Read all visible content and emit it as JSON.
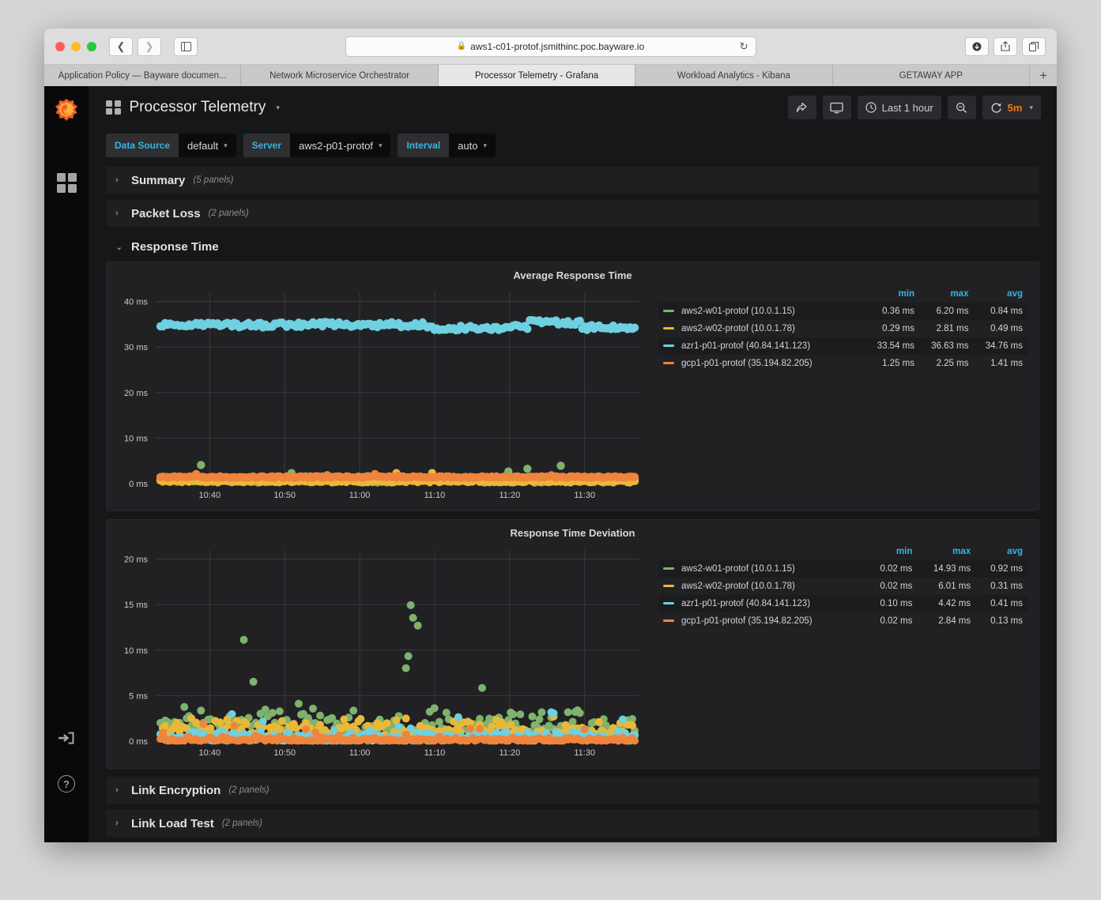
{
  "browser": {
    "url": "aws1-c01-protof.jsmithinc.poc.bayware.io",
    "lock_icon": "lock-icon",
    "reload_icon": "reload-icon",
    "back_icon": "chevron-left-icon",
    "forward_icon": "chevron-right-icon",
    "sidebar_icon": "sidebar-toggle-icon",
    "download_icon": "download-icon",
    "share_icon": "share-icon",
    "tabs_icon": "tab-overview-icon",
    "new_tab_label": "+",
    "tabs": [
      {
        "label": "Application Policy — Bayware documen...",
        "active": false
      },
      {
        "label": "Network Microservice Orchestrator",
        "active": false
      },
      {
        "label": "Processor Telemetry - Grafana",
        "active": true
      },
      {
        "label": "Workload Analytics - Kibana",
        "active": false
      },
      {
        "label": "GETAWAY APP",
        "active": false
      }
    ]
  },
  "sidebar": {
    "logo": "grafana-logo-icon",
    "items": [
      {
        "name": "dashboards-icon"
      },
      {
        "name": "sign-in-icon"
      },
      {
        "name": "help-icon",
        "glyph": "?"
      }
    ]
  },
  "header": {
    "title": "Processor Telemetry",
    "title_caret": "▾",
    "share_label": "share-icon",
    "tv_label": "tv-mode-icon",
    "time_range": "Last 1 hour",
    "clock_icon": "clock-icon",
    "zoom_out_icon": "zoom-out-icon",
    "refresh_icon": "refresh-icon",
    "refresh_interval": "5m",
    "refresh_caret": "▾"
  },
  "submenu": {
    "vars": [
      {
        "label": "Data Source",
        "value": "default",
        "caret": "▾"
      },
      {
        "label": "Server",
        "value": "aws2-p01-protof",
        "caret": "▾"
      },
      {
        "label": "Interval",
        "value": "auto",
        "caret": "▾"
      }
    ]
  },
  "rows": [
    {
      "title": "Summary",
      "count": "(5 panels)",
      "expanded": false,
      "chevron": "›"
    },
    {
      "title": "Packet Loss",
      "count": "(2 panels)",
      "expanded": false,
      "chevron": "›"
    },
    {
      "title": "Response Time",
      "count": "",
      "expanded": true,
      "chevron": "⌄"
    },
    {
      "title": "Link Encryption",
      "count": "(2 panels)",
      "expanded": false,
      "chevron": "›"
    },
    {
      "title": "Link Load Test",
      "count": "(2 panels)",
      "expanded": false,
      "chevron": "›"
    }
  ],
  "legend_headers": {
    "name": "",
    "min": "min",
    "max": "max",
    "avg": "avg"
  },
  "colors": {
    "green": "#7eb26d",
    "yellow": "#eab839",
    "cyan": "#6ed0e0",
    "orange": "#ef843c",
    "accent_blue": "#33b5e5",
    "accent_orange": "#eb7b18",
    "panel_bg": "#212124",
    "page_bg": "#161719"
  },
  "chart_data": [
    {
      "type": "scatter",
      "title": "Average Response Time",
      "xlabel": "",
      "ylabel": "",
      "ylim": [
        0,
        42
      ],
      "yticks": [
        0,
        10,
        20,
        30,
        40
      ],
      "ytick_labels": [
        "0 ms",
        "10 ms",
        "20 ms",
        "30 ms",
        "40 ms"
      ],
      "xticks": [
        "10:40",
        "10:50",
        "11:00",
        "11:10",
        "11:20",
        "11:30"
      ],
      "grid": true,
      "legend_position": "right",
      "series": [
        {
          "name": "aws2-w01-protof (10.0.1.15)",
          "color": "#7eb26d",
          "min": "0.36 ms",
          "max": "6.20 ms",
          "avg": "0.84 ms",
          "mean": 0.84,
          "spread": 1.4,
          "spike_max": 6.2
        },
        {
          "name": "aws2-w02-protof (10.0.1.78)",
          "color": "#eab839",
          "min": "0.29 ms",
          "max": "2.81 ms",
          "avg": "0.49 ms",
          "mean": 0.49,
          "spread": 0.5,
          "spike_max": 2.81
        },
        {
          "name": "azr1-p01-protof (40.84.141.123)",
          "color": "#6ed0e0",
          "min": "33.54 ms",
          "max": "36.63 ms",
          "avg": "34.76 ms",
          "mean": 34.76,
          "spread": 1.2,
          "spike_max": 36.63
        },
        {
          "name": "gcp1-p01-protof (35.194.82.205)",
          "color": "#ef843c",
          "min": "1.25 ms",
          "max": "2.25 ms",
          "avg": "1.41 ms",
          "mean": 1.41,
          "spread": 0.35,
          "spike_max": 2.25
        }
      ]
    },
    {
      "type": "scatter",
      "title": "Response Time Deviation",
      "xlabel": "",
      "ylabel": "",
      "ylim": [
        0,
        21
      ],
      "yticks": [
        0,
        5,
        10,
        15,
        20
      ],
      "ytick_labels": [
        "0 ms",
        "5 ms",
        "10 ms",
        "15 ms",
        "20 ms"
      ],
      "xticks": [
        "10:40",
        "10:50",
        "11:00",
        "11:10",
        "11:20",
        "11:30"
      ],
      "grid": true,
      "legend_position": "right",
      "series": [
        {
          "name": "aws2-w01-protof (10.0.1.15)",
          "color": "#7eb26d",
          "min": "0.02 ms",
          "max": "14.93 ms",
          "avg": "0.92 ms",
          "mean": 2.6,
          "spread": 1.8,
          "spike_max": 14.93
        },
        {
          "name": "aws2-w02-protof (10.0.1.78)",
          "color": "#eab839",
          "min": "0.02 ms",
          "max": "6.01 ms",
          "avg": "0.31 ms",
          "mean": 1.6,
          "spread": 1.5,
          "spike_max": 6.01
        },
        {
          "name": "azr1-p01-protof (40.84.141.123)",
          "color": "#6ed0e0",
          "min": "0.10 ms",
          "max": "4.42 ms",
          "avg": "0.41 ms",
          "mean": 0.7,
          "spread": 0.7,
          "spike_max": 4.42
        },
        {
          "name": "gcp1-p01-protof (35.194.82.205)",
          "color": "#ef843c",
          "min": "0.02 ms",
          "max": "2.84 ms",
          "avg": "0.13 ms",
          "mean": 0.25,
          "spread": 0.4,
          "spike_max": 2.84
        }
      ]
    }
  ]
}
